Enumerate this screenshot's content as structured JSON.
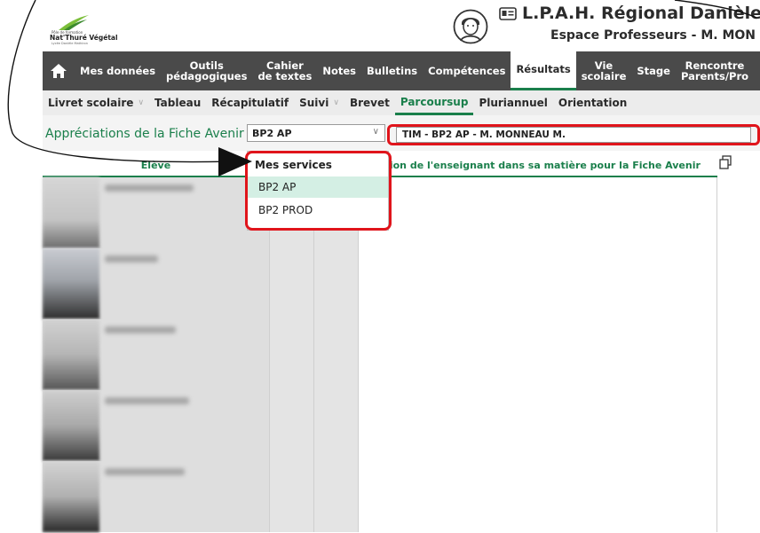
{
  "header": {
    "logo": {
      "top_line": "Pôle de formation",
      "name": "Nat'Thuré Végétal",
      "sub_line": "Lycée Danièle Mathiron"
    },
    "school_title": "L.P.A.H. Régional Danièle",
    "space_subtitle": "Espace Professeurs - M. MON"
  },
  "main_nav": {
    "items": [
      {
        "label": "Mes données"
      },
      {
        "label": "Outils\npédagogiques"
      },
      {
        "label": "Cahier\nde textes"
      },
      {
        "label": "Notes"
      },
      {
        "label": "Bulletins"
      },
      {
        "label": "Compétences"
      },
      {
        "label": "Résultats",
        "active": true
      },
      {
        "label": "Vie\nscolaire"
      },
      {
        "label": "Stage"
      },
      {
        "label": "Rencontre\nParents/Pro"
      }
    ]
  },
  "sub_nav": {
    "items": [
      {
        "label": "Livret scolaire",
        "has_menu": true
      },
      {
        "label": "Tableau"
      },
      {
        "label": "Récapitulatif"
      },
      {
        "label": "Suivi",
        "has_menu": true
      },
      {
        "label": "Brevet"
      },
      {
        "label": "Parcoursup",
        "active": true
      },
      {
        "label": "Pluriannuel"
      },
      {
        "label": "Orientation"
      }
    ]
  },
  "filter": {
    "label": "Appréciations de la Fiche Avenir",
    "class_select_value": "BP2 AP",
    "service_value": "TIM - BP2 AP - M. MONNEAU M."
  },
  "table": {
    "col_student": "Elève",
    "col_appreciation": "réciation de l'enseignant dans sa matière pour la Fiche Avenir"
  },
  "dropdown": {
    "group_label": "Mes services",
    "options": [
      {
        "label": "BP2 AP",
        "selected": true
      },
      {
        "label": "BP2 PROD",
        "selected": false
      }
    ]
  },
  "colors": {
    "accent_green": "#1a7f4b",
    "nav_dark": "#4a4a4a",
    "annotation_red": "#e0141b",
    "selected_option": "#d4efe4"
  },
  "icons": {
    "home": "home-icon",
    "id_card": "id-card-icon",
    "avatar": "user-avatar-icon",
    "copy": "copy-icon",
    "chevron": "chevron-down-icon"
  }
}
